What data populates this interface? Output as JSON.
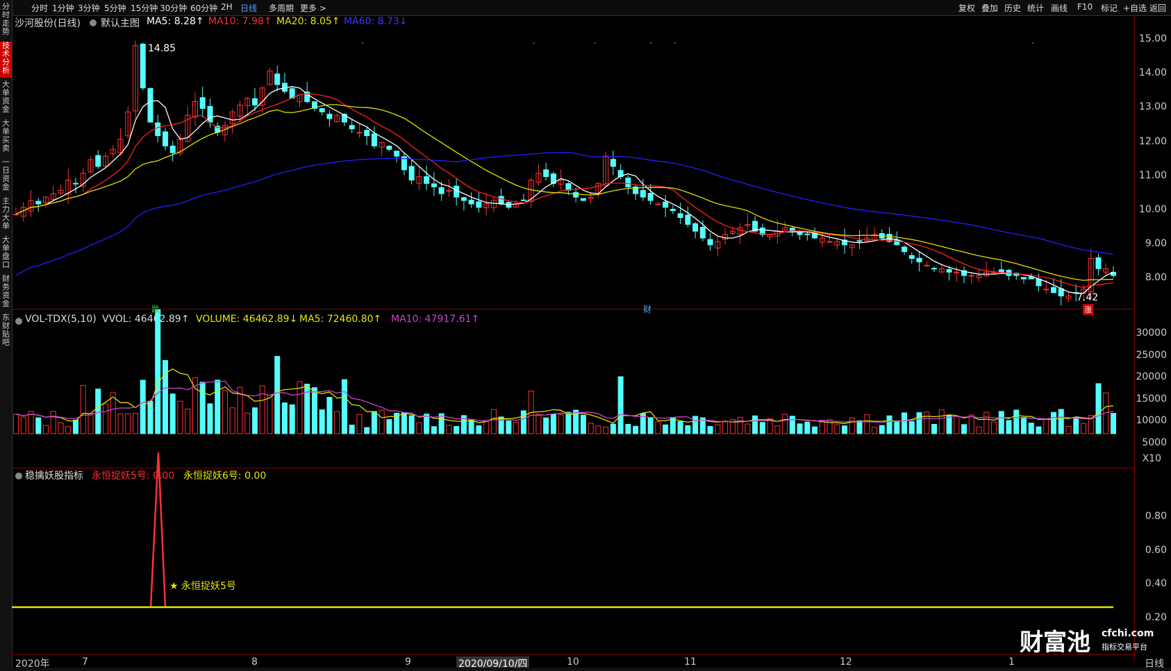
{
  "toolbar": {
    "periods": [
      "分时",
      "1分钟",
      "3分钟",
      "5分钟",
      "15分钟",
      "30分钟",
      "60分钟",
      "2H",
      "日线",
      "多周期",
      "更多 >"
    ],
    "active_period": "日线",
    "tools": [
      "复权",
      "叠加",
      "历史",
      "统计",
      "画线",
      "F10",
      "标记",
      "+自选",
      "返回"
    ]
  },
  "sidetabs": [
    {
      "label": "分时走势",
      "active": false
    },
    {
      "label": "技术分析",
      "active": true
    },
    {
      "label": "大单资金",
      "active": false
    },
    {
      "label": "大单买卖",
      "active": false
    },
    {
      "label": "一日资金",
      "active": false
    },
    {
      "label": "主力大单",
      "active": false
    },
    {
      "label": "大单盘口",
      "active": false
    },
    {
      "label": "财务资金",
      "active": false
    },
    {
      "label": "东财贴吧",
      "active": false
    }
  ],
  "price_pane": {
    "stock_name": "沙河股份(日线)",
    "indicator": "默认主图",
    "ma5": "MA5: 8.28↑",
    "ma10": "MA10: 7.98↑",
    "ma20": "MA20: 8.05↑",
    "ma60": "MA60: 8.73↓",
    "high_label": "14.85",
    "low_label": "7.42",
    "axis": [
      "15.00",
      "14.00",
      "13.00",
      "12.00",
      "11.00",
      "10.00",
      "9.00",
      "8.00"
    ],
    "markers": {
      "die": "跌",
      "cai": "财",
      "zhang": "涨"
    }
  },
  "volume_pane": {
    "name": "VOL-TDX(5,10)",
    "vvol": "VVOL: 46462.89↑",
    "volume": "VOLUME: 46462.89↓",
    "ma5": "MA5: 72460.80↑",
    "ma10": "MA10: 47917.61↑",
    "axis": [
      "30000",
      "25000",
      "20000",
      "15000",
      "10000",
      "5000"
    ],
    "unit": "X10"
  },
  "indicator_pane": {
    "name": "稳擒妖股指标",
    "s5": "永恒捉妖5号: 0.00",
    "s6": "永恒捉妖6号: 0.00",
    "signal_label": "★ 永恒捉妖5号",
    "axis": [
      "0.80",
      "0.60",
      "0.40",
      "0.20"
    ]
  },
  "xaxis": {
    "labels": [
      "2020年",
      "7",
      "8",
      "9",
      "10",
      "11",
      "12",
      "1"
    ],
    "cursor_date": "2020/09/10/四",
    "period": "日线"
  },
  "watermark": {
    "brand": "财富池",
    "domain": "cfchi.com",
    "tagline": "指标交易平台"
  },
  "colors": {
    "up": "#ff3232",
    "down": "#54ffff",
    "ma5": "#ffffff",
    "ma10": "#ff2020",
    "ma20": "#e0e000",
    "ma60": "#2020ff",
    "vma10": "#cc44cc"
  },
  "series": {
    "closes": [
      9.9,
      10.1,
      10.3,
      10.2,
      10.4,
      10.5,
      10.6,
      10.9,
      10.8,
      11.1,
      11.5,
      11.3,
      11.6,
      11.8,
      12.1,
      12.9,
      14.85,
      13.6,
      12.6,
      12.2,
      11.9,
      11.7,
      12.1,
      12.8,
      13.2,
      13.0,
      12.6,
      12.3,
      12.5,
      12.9,
      13.1,
      13.3,
      13.1,
      13.6,
      14.1,
      13.7,
      13.5,
      13.3,
      13.4,
      13.2,
      13.0,
      12.9,
      12.7,
      12.8,
      12.6,
      12.4,
      12.3,
      12.2,
      11.9,
      12.0,
      11.8,
      11.6,
      11.2,
      10.9,
      11.0,
      10.8,
      10.7,
      10.5,
      10.6,
      10.4,
      10.3,
      10.2,
      10.1,
      10.2,
      10.3,
      10.2,
      10.1,
      10.2,
      10.3,
      10.9,
      11.1,
      11.0,
      10.8,
      10.9,
      10.6,
      10.4,
      10.3,
      10.4,
      10.8,
      11.6,
      11.3,
      11.0,
      10.7,
      10.5,
      10.4,
      10.3,
      10.2,
      10.1,
      10.0,
      9.8,
      9.6,
      9.4,
      9.2,
      9.0,
      9.1,
      9.3,
      9.4,
      9.5,
      9.6,
      9.4,
      9.3,
      9.3,
      9.4,
      9.5,
      9.4,
      9.3,
      9.3,
      9.2,
      9.2,
      9.1,
      9.1,
      9.0,
      9.0,
      9.1,
      9.2,
      9.3,
      9.2,
      9.1,
      9.0,
      8.8,
      8.6,
      8.5,
      8.4,
      8.3,
      8.3,
      8.2,
      8.2,
      8.1,
      8.1,
      8.1,
      8.2,
      8.2,
      8.2,
      8.1,
      8.1,
      8.0,
      8.0,
      7.8,
      7.7,
      7.6,
      7.5,
      7.5,
      7.6,
      7.7,
      8.6,
      8.3,
      8.3,
      8.1
    ]
  }
}
